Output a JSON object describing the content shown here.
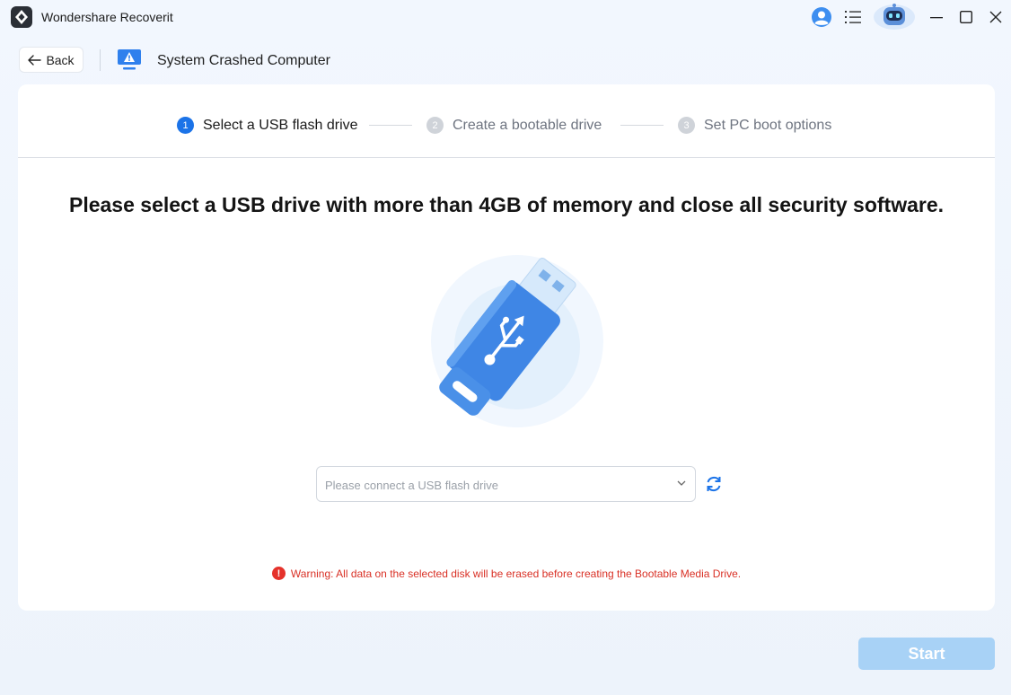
{
  "app": {
    "title": "Wondershare Recoverit"
  },
  "titlebar": {
    "icons": [
      "user-icon",
      "menu-icon",
      "robot-assistant-icon",
      "minimize-icon",
      "maximize-icon",
      "close-icon"
    ]
  },
  "header": {
    "back_label": "Back",
    "title": "System Crashed Computer"
  },
  "steps": [
    {
      "number": "1",
      "label": "Select a USB flash drive",
      "state": "active"
    },
    {
      "number": "2",
      "label": "Create a bootable drive",
      "state": "inactive"
    },
    {
      "number": "3",
      "label": "Set PC boot options",
      "state": "inactive"
    }
  ],
  "main": {
    "headline": "Please select a USB drive with more than 4GB of memory and close all security software.",
    "usb_select": {
      "placeholder": "Please connect a USB flash drive",
      "value": ""
    },
    "warning": "Warning: All data on the selected disk will be erased before creating the Bootable Media Drive."
  },
  "footer": {
    "start_label": "Start",
    "start_enabled": false
  },
  "colors": {
    "accent": "#1b73e8",
    "warning": "#d93025",
    "start_disabled": "#a8d2f6",
    "background": "#eef4fc"
  }
}
